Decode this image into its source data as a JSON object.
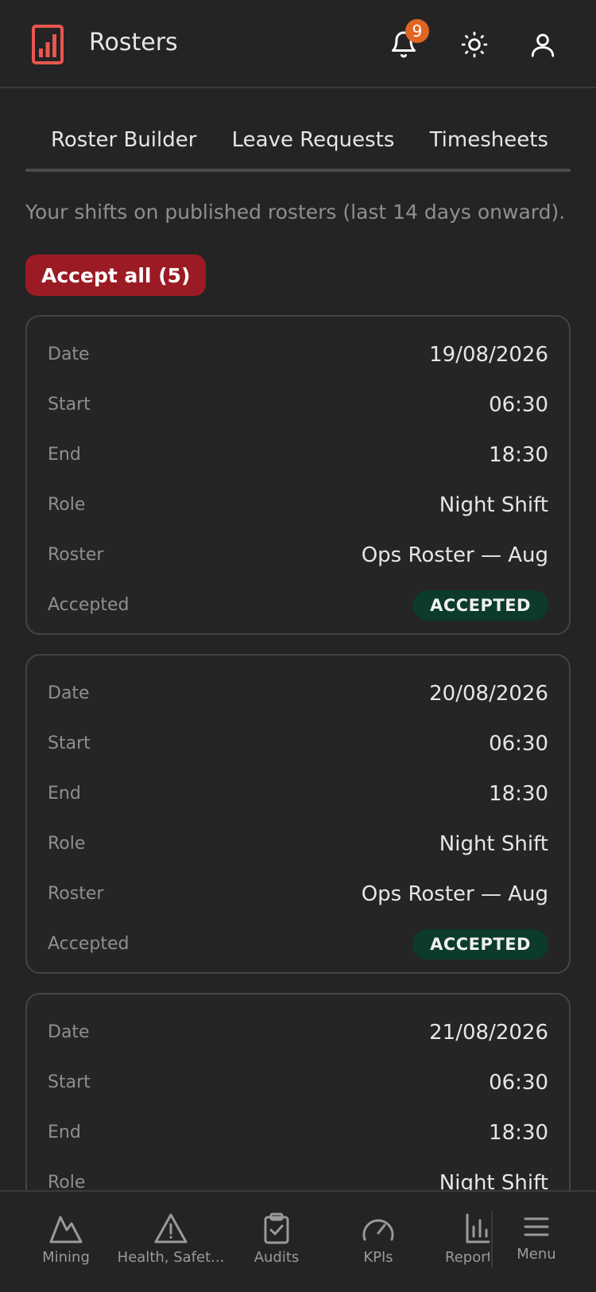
{
  "header": {
    "title": "Rosters",
    "notification_count": "9"
  },
  "tabs": [
    {
      "label": "Roster Builder"
    },
    {
      "label": "Leave Requests"
    },
    {
      "label": "Timesheets"
    }
  ],
  "intro": "Your shifts on published rosters (last 14 days onward).",
  "accept_all_label": "Accept all (5)",
  "shifts": [
    {
      "date_label": "Date",
      "date": "19/08/2026",
      "start_label": "Start",
      "start": "06:30",
      "end_label": "End",
      "end": "18:30",
      "role_label": "Role",
      "role": "Night Shift",
      "roster_label": "Roster",
      "roster": "Ops Roster — Aug",
      "accepted_label": "Accepted",
      "status": "ACCEPTED"
    },
    {
      "date_label": "Date",
      "date": "20/08/2026",
      "start_label": "Start",
      "start": "06:30",
      "end_label": "End",
      "end": "18:30",
      "role_label": "Role",
      "role": "Night Shift",
      "roster_label": "Roster",
      "roster": "Ops Roster — Aug",
      "accepted_label": "Accepted",
      "status": "ACCEPTED"
    },
    {
      "date_label": "Date",
      "date": "21/08/2026",
      "start_label": "Start",
      "start": "06:30",
      "end_label": "End",
      "end": "18:30",
      "role_label": "Role",
      "role": "Night Shift"
    }
  ],
  "bottom_nav": [
    {
      "label": "Mining",
      "icon": "mountain-icon"
    },
    {
      "label": "Health, Safet...",
      "icon": "warning-icon"
    },
    {
      "label": "Audits",
      "icon": "clipboard-check-icon"
    },
    {
      "label": "KPIs",
      "icon": "gauge-icon"
    },
    {
      "label": "Report",
      "icon": "bar-chart-icon"
    },
    {
      "label": "Menu",
      "icon": "hamburger-icon"
    }
  ],
  "colors": {
    "accent": "#9b1b24",
    "badge": "#e06524",
    "accepted_pill": "#0c3b2a",
    "logo": "#e8574f"
  }
}
